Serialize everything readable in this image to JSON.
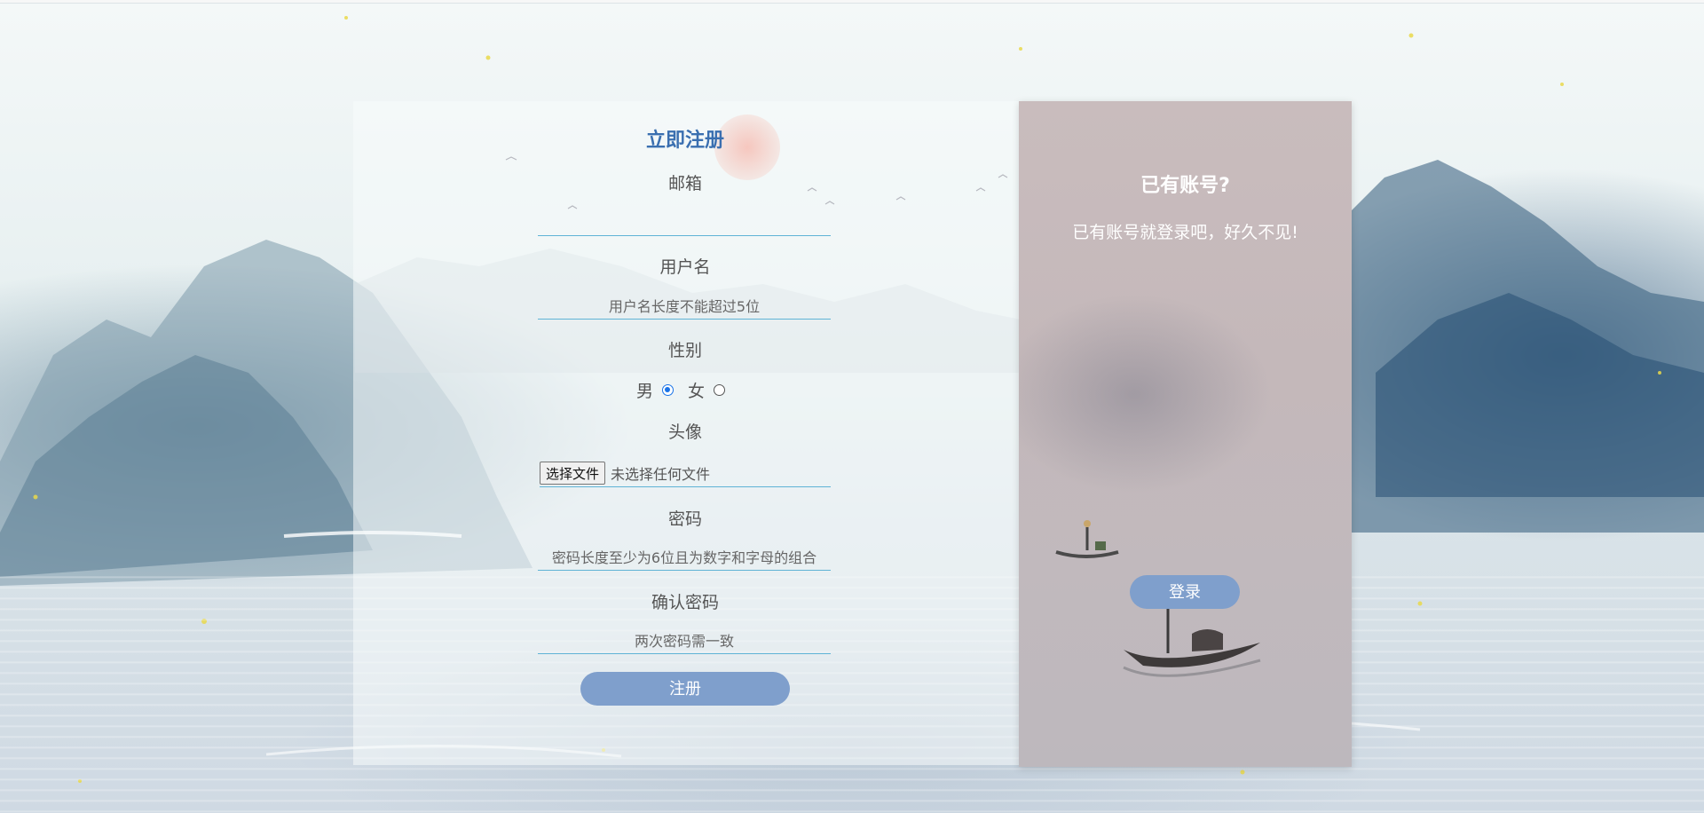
{
  "register": {
    "title": "立即注册",
    "email": {
      "label": "邮箱",
      "placeholder": ""
    },
    "username": {
      "label": "用户名",
      "placeholder": "用户名长度不能超过5位"
    },
    "gender": {
      "label": "性别",
      "male": "男",
      "female": "女",
      "selected": "男"
    },
    "avatar": {
      "label": "头像",
      "button": "选择文件",
      "status": "未选择任何文件"
    },
    "password": {
      "label": "密码",
      "placeholder": "密码长度至少为6位且为数字和字母的组合"
    },
    "confirm": {
      "label": "确认密码",
      "placeholder": "两次密码需一致"
    },
    "submit": "注册"
  },
  "login": {
    "title": "已有账号?",
    "text": "已有账号就登录吧，好久不见!",
    "button": "登录"
  },
  "colors": {
    "accent_button": "#7f9fcc",
    "title_blue": "#3a6fb0",
    "input_underline": "#5fb3d6"
  }
}
